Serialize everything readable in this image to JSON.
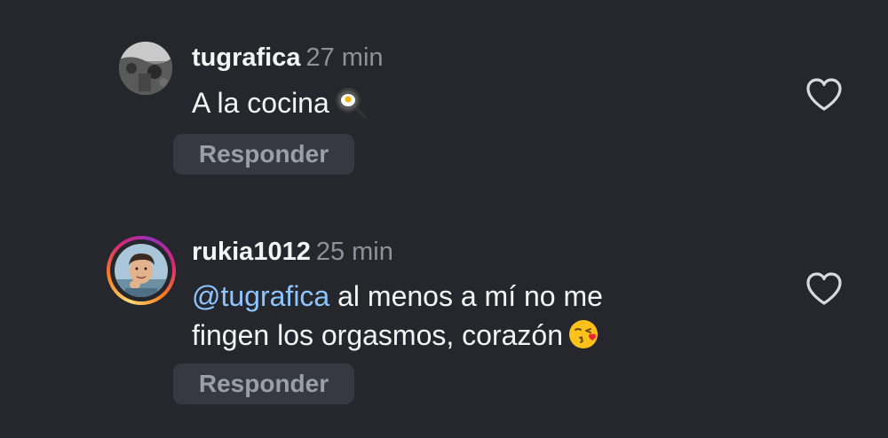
{
  "comments": [
    {
      "username": "tugrafica",
      "time": "27 min",
      "text": "A la cocina",
      "emoji_icon": "frying-pan-egg-icon",
      "reply_label": "Responder",
      "like_icon": "heart-outline-icon",
      "has_story_ring": false
    },
    {
      "username": "rukia1012",
      "time": "25 min",
      "mention": "@tugrafica",
      "text_line1": " al menos a mí no me",
      "text_line2": "fingen los orgasmos, corazón",
      "emoji_icon": "face-blowing-kiss-icon",
      "reply_label": "Responder",
      "like_icon": "heart-outline-icon",
      "has_story_ring": true
    }
  ],
  "colors": {
    "background": "#25272c",
    "username": "#f3f4f6",
    "timestamp": "#8e929b",
    "mention": "#8ec5ff",
    "reply_button_bg": "#363941",
    "reply_button_text": "#9aa0a8"
  }
}
